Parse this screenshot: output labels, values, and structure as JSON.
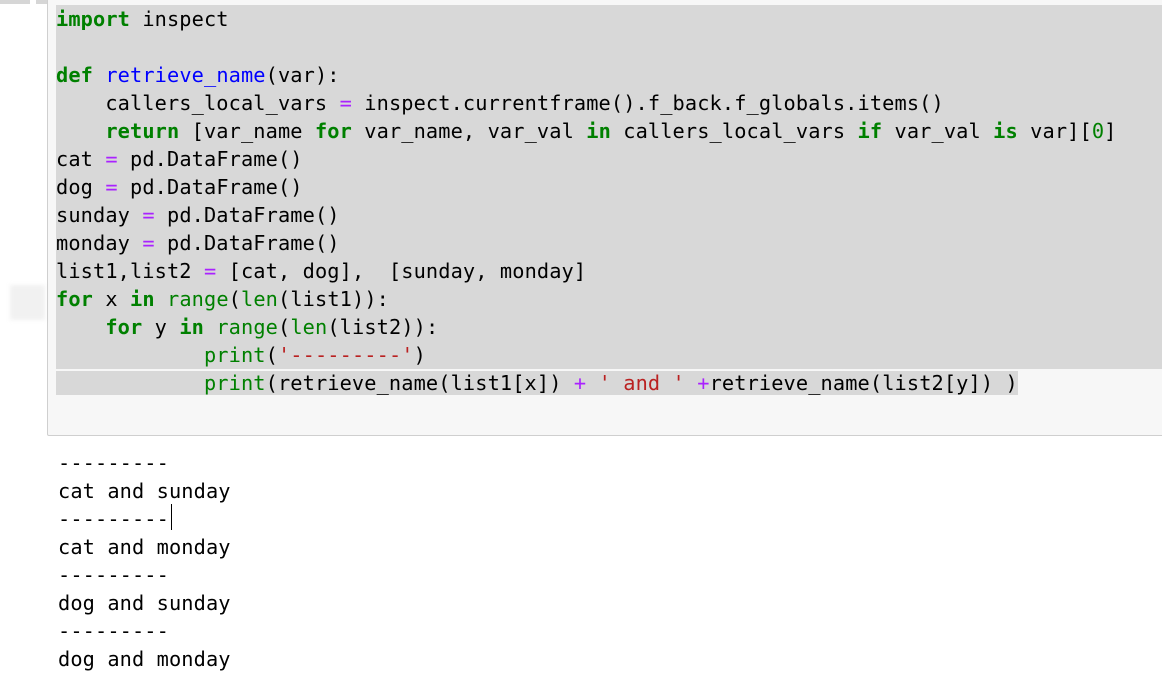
{
  "cell": {
    "code_lines": [
      [
        {
          "t": "kw",
          "v": "import"
        },
        {
          "t": "",
          "v": " inspect"
        }
      ],
      [],
      [
        {
          "t": "kw",
          "v": "def"
        },
        {
          "t": "",
          "v": " "
        },
        {
          "t": "fn",
          "v": "retrieve_name"
        },
        {
          "t": "",
          "v": "(var):"
        }
      ],
      [
        {
          "t": "",
          "v": "    callers_local_vars "
        },
        {
          "t": "op",
          "v": "="
        },
        {
          "t": "",
          "v": " inspect.currentframe().f_back.f_globals.items()"
        }
      ],
      [
        {
          "t": "",
          "v": "    "
        },
        {
          "t": "kw",
          "v": "return"
        },
        {
          "t": "",
          "v": " [var_name "
        },
        {
          "t": "kw",
          "v": "for"
        },
        {
          "t": "",
          "v": " var_name, var_val "
        },
        {
          "t": "kw",
          "v": "in"
        },
        {
          "t": "",
          "v": " callers_local_vars "
        },
        {
          "t": "kw",
          "v": "if"
        },
        {
          "t": "",
          "v": " var_val "
        },
        {
          "t": "kw",
          "v": "is"
        },
        {
          "t": "",
          "v": " var]["
        },
        {
          "t": "num",
          "v": "0"
        },
        {
          "t": "",
          "v": "]"
        }
      ],
      [
        {
          "t": "",
          "v": "cat "
        },
        {
          "t": "op",
          "v": "="
        },
        {
          "t": "",
          "v": " pd.DataFrame()"
        }
      ],
      [
        {
          "t": "",
          "v": "dog "
        },
        {
          "t": "op",
          "v": "="
        },
        {
          "t": "",
          "v": " pd.DataFrame()"
        }
      ],
      [
        {
          "t": "",
          "v": "sunday "
        },
        {
          "t": "op",
          "v": "="
        },
        {
          "t": "",
          "v": " pd.DataFrame()"
        }
      ],
      [
        {
          "t": "",
          "v": "monday "
        },
        {
          "t": "op",
          "v": "="
        },
        {
          "t": "",
          "v": " pd.DataFrame()"
        }
      ],
      [
        {
          "t": "",
          "v": "list1,list2 "
        },
        {
          "t": "op",
          "v": "="
        },
        {
          "t": "",
          "v": " [cat, dog],  [sunday, monday]"
        }
      ],
      [
        {
          "t": "kw",
          "v": "for"
        },
        {
          "t": "",
          "v": " x "
        },
        {
          "t": "kw",
          "v": "in"
        },
        {
          "t": "",
          "v": " "
        },
        {
          "t": "bi",
          "v": "range"
        },
        {
          "t": "",
          "v": "("
        },
        {
          "t": "bi",
          "v": "len"
        },
        {
          "t": "",
          "v": "(list1)):"
        }
      ],
      [
        {
          "t": "",
          "v": "    "
        },
        {
          "t": "kw",
          "v": "for"
        },
        {
          "t": "",
          "v": " y "
        },
        {
          "t": "kw",
          "v": "in"
        },
        {
          "t": "",
          "v": " "
        },
        {
          "t": "bi",
          "v": "range"
        },
        {
          "t": "",
          "v": "("
        },
        {
          "t": "bi",
          "v": "len"
        },
        {
          "t": "",
          "v": "(list2)):"
        }
      ],
      [
        {
          "t": "",
          "v": "            "
        },
        {
          "t": "bi",
          "v": "print"
        },
        {
          "t": "",
          "v": "("
        },
        {
          "t": "str",
          "v": "'---------'"
        },
        {
          "t": "",
          "v": ")"
        }
      ],
      [
        {
          "t": "",
          "v": "            "
        },
        {
          "t": "bi",
          "v": "print"
        },
        {
          "t": "",
          "v": "(retrieve_name(list1[x]) "
        },
        {
          "t": "op",
          "v": "+"
        },
        {
          "t": "",
          "v": " "
        },
        {
          "t": "str",
          "v": "' and '"
        },
        {
          "t": "",
          "v": " "
        },
        {
          "t": "op",
          "v": "+"
        },
        {
          "t": "",
          "v": "retrieve_name(list2[y]) )"
        }
      ]
    ]
  },
  "output": {
    "lines": [
      "---------",
      "cat and sunday",
      "---------",
      "cat and monday",
      "---------",
      "dog and sunday",
      "---------",
      "dog and monday"
    ]
  },
  "colors": {
    "keyword": "#008000",
    "builtin": "#008000",
    "function_def": "#0000ff",
    "operator": "#aa22ff",
    "string": "#ba2121",
    "number": "#008000",
    "selection": "#d8d8d8",
    "cell_background": "#f7f7f7",
    "cell_border": "#cfcfcf"
  }
}
